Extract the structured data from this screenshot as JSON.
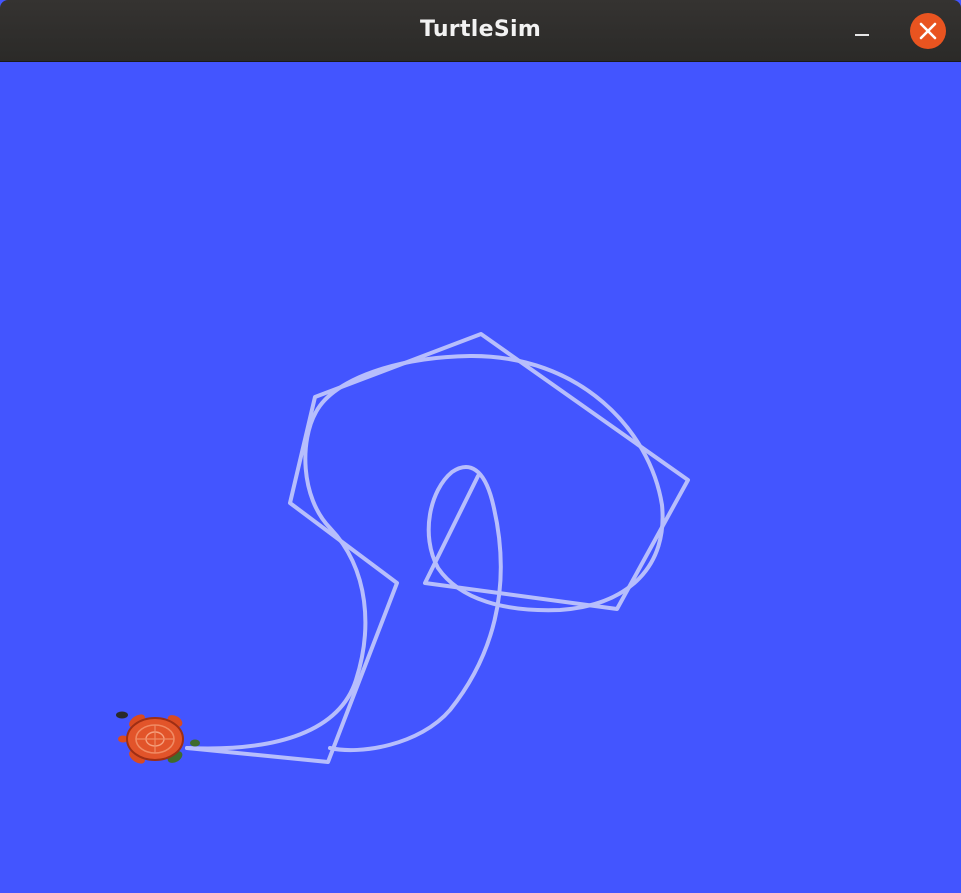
{
  "window": {
    "title": "TurtleSim",
    "controls": {
      "minimize": "minimize-icon",
      "close": "close-icon"
    }
  },
  "canvas": {
    "background_color": "#4355ff",
    "pen_color": "#b7befc",
    "turtle": {
      "icon": "turtle-icon",
      "shell_color": "#e2542a",
      "heading": "east"
    }
  }
}
